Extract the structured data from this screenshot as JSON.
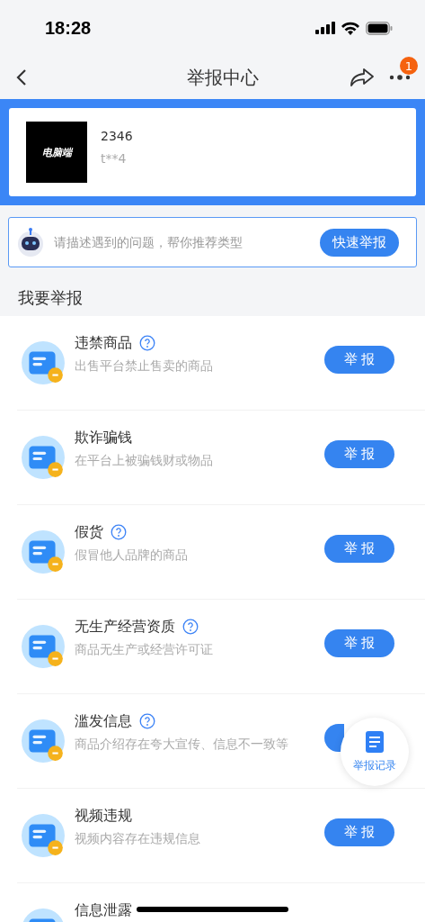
{
  "status_bar": {
    "time": "18:28"
  },
  "nav": {
    "title": "举报中心",
    "badge": "1"
  },
  "target": {
    "logo": "电脑端",
    "name": "2346",
    "user": "t**4"
  },
  "quick": {
    "placeholder": "请描述遇到的问题，帮你推荐类型",
    "button": "快速举报"
  },
  "section_title": "我要举报",
  "items": [
    {
      "title": "违禁商品",
      "help": true,
      "desc": "出售平台禁止售卖的商品",
      "button": "举 报"
    },
    {
      "title": "欺诈骗钱",
      "help": false,
      "desc": "在平台上被骗钱财或物品",
      "button": "举 报"
    },
    {
      "title": "假货",
      "help": true,
      "desc": "假冒他人品牌的商品",
      "button": "举 报"
    },
    {
      "title": "无生产经营资质",
      "help": true,
      "desc": "商品无生产或经营许可证",
      "button": "举 报"
    },
    {
      "title": "滥发信息",
      "help": true,
      "desc": "商品介绍存在夸大宣传、信息不一致等"
    },
    {
      "title": "视频违规",
      "help": false,
      "desc": "视频内容存在违规信息",
      "button": "举 报"
    },
    {
      "title": "信息泄露",
      "help": false
    }
  ],
  "float_button": {
    "label": "举报记录"
  }
}
